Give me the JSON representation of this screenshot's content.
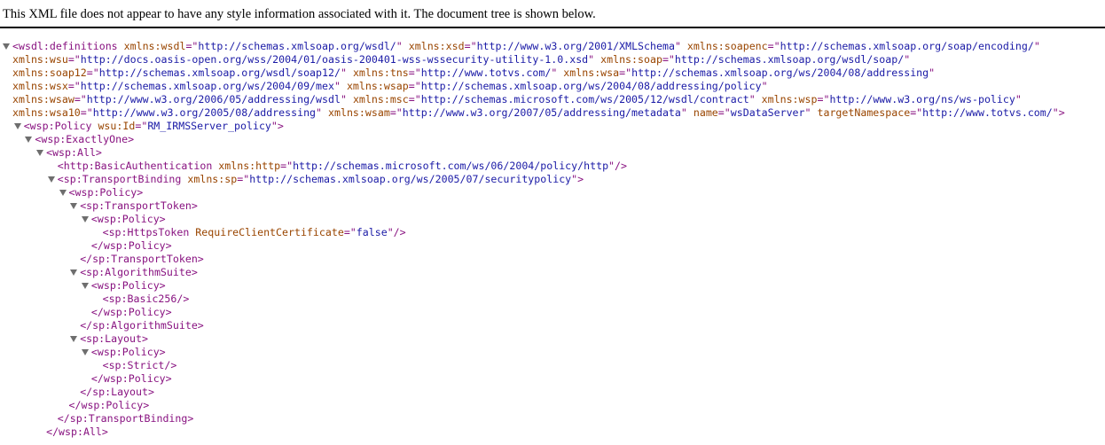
{
  "banner": "This XML file does not appear to have any style information associated with it. The document tree is shown below.",
  "lines": [
    {
      "indent": 0,
      "toggle": true,
      "segs": [
        [
          "t",
          "<wsdl:definitions "
        ],
        [
          "n",
          "xmlns:wsdl"
        ],
        [
          "t",
          "=\""
        ],
        [
          "v",
          "http://schemas.xmlsoap.org/wsdl/"
        ],
        [
          "t",
          "\" "
        ],
        [
          "n",
          "xmlns:xsd"
        ],
        [
          "t",
          "=\""
        ],
        [
          "v",
          "http://www.w3.org/2001/XMLSchema"
        ],
        [
          "t",
          "\" "
        ],
        [
          "n",
          "xmlns:soapenc"
        ],
        [
          "t",
          "=\""
        ],
        [
          "v",
          "http://schemas.xmlsoap.org/soap/encoding/"
        ],
        [
          "t",
          "\""
        ]
      ]
    },
    {
      "indent": 0,
      "wrap": true,
      "segs": [
        [
          "n",
          "xmlns:wsu"
        ],
        [
          "t",
          "=\""
        ],
        [
          "v",
          "http://docs.oasis-open.org/wss/2004/01/oasis-200401-wss-wssecurity-utility-1.0.xsd"
        ],
        [
          "t",
          "\" "
        ],
        [
          "n",
          "xmlns:soap"
        ],
        [
          "t",
          "=\""
        ],
        [
          "v",
          "http://schemas.xmlsoap.org/wsdl/soap/"
        ],
        [
          "t",
          "\""
        ]
      ]
    },
    {
      "indent": 0,
      "wrap": true,
      "segs": [
        [
          "n",
          "xmlns:soap12"
        ],
        [
          "t",
          "=\""
        ],
        [
          "v",
          "http://schemas.xmlsoap.org/wsdl/soap12/"
        ],
        [
          "t",
          "\" "
        ],
        [
          "n",
          "xmlns:tns"
        ],
        [
          "t",
          "=\""
        ],
        [
          "v",
          "http://www.totvs.com/"
        ],
        [
          "t",
          "\" "
        ],
        [
          "n",
          "xmlns:wsa"
        ],
        [
          "t",
          "=\""
        ],
        [
          "v",
          "http://schemas.xmlsoap.org/ws/2004/08/addressing"
        ],
        [
          "t",
          "\""
        ]
      ]
    },
    {
      "indent": 0,
      "wrap": true,
      "segs": [
        [
          "n",
          "xmlns:wsx"
        ],
        [
          "t",
          "=\""
        ],
        [
          "v",
          "http://schemas.xmlsoap.org/ws/2004/09/mex"
        ],
        [
          "t",
          "\" "
        ],
        [
          "n",
          "xmlns:wsap"
        ],
        [
          "t",
          "=\""
        ],
        [
          "v",
          "http://schemas.xmlsoap.org/ws/2004/08/addressing/policy"
        ],
        [
          "t",
          "\""
        ]
      ]
    },
    {
      "indent": 0,
      "wrap": true,
      "segs": [
        [
          "n",
          "xmlns:wsaw"
        ],
        [
          "t",
          "=\""
        ],
        [
          "v",
          "http://www.w3.org/2006/05/addressing/wsdl"
        ],
        [
          "t",
          "\" "
        ],
        [
          "n",
          "xmlns:msc"
        ],
        [
          "t",
          "=\""
        ],
        [
          "v",
          "http://schemas.microsoft.com/ws/2005/12/wsdl/contract"
        ],
        [
          "t",
          "\" "
        ],
        [
          "n",
          "xmlns:wsp"
        ],
        [
          "t",
          "=\""
        ],
        [
          "v",
          "http://www.w3.org/ns/ws-policy"
        ],
        [
          "t",
          "\""
        ]
      ]
    },
    {
      "indent": 0,
      "wrap": true,
      "segs": [
        [
          "n",
          "xmlns:wsa10"
        ],
        [
          "t",
          "=\""
        ],
        [
          "v",
          "http://www.w3.org/2005/08/addressing"
        ],
        [
          "t",
          "\" "
        ],
        [
          "n",
          "xmlns:wsam"
        ],
        [
          "t",
          "=\""
        ],
        [
          "v",
          "http://www.w3.org/2007/05/addressing/metadata"
        ],
        [
          "t",
          "\" "
        ],
        [
          "n",
          "name"
        ],
        [
          "t",
          "=\""
        ],
        [
          "v",
          "wsDataServer"
        ],
        [
          "t",
          "\" "
        ],
        [
          "n",
          "targetNamespace"
        ],
        [
          "t",
          "=\""
        ],
        [
          "v",
          "http://www.totvs.com/"
        ],
        [
          "t",
          "\">"
        ]
      ]
    },
    {
      "indent": 1,
      "toggle": true,
      "segs": [
        [
          "t",
          "<wsp:Policy "
        ],
        [
          "n",
          "wsu:Id"
        ],
        [
          "t",
          "=\""
        ],
        [
          "v",
          "RM_IRMSServer_policy"
        ],
        [
          "t",
          "\">"
        ]
      ]
    },
    {
      "indent": 2,
      "toggle": true,
      "segs": [
        [
          "t",
          "<wsp:ExactlyOne>"
        ]
      ]
    },
    {
      "indent": 3,
      "toggle": true,
      "segs": [
        [
          "t",
          "<wsp:All>"
        ]
      ]
    },
    {
      "indent": 4,
      "toggle": false,
      "segs": [
        [
          "t",
          "<http:BasicAuthentication "
        ],
        [
          "n",
          "xmlns:http"
        ],
        [
          "t",
          "=\""
        ],
        [
          "v",
          "http://schemas.microsoft.com/ws/06/2004/policy/http"
        ],
        [
          "t",
          "\"/>"
        ]
      ]
    },
    {
      "indent": 4,
      "toggle": true,
      "segs": [
        [
          "t",
          "<sp:TransportBinding "
        ],
        [
          "n",
          "xmlns:sp"
        ],
        [
          "t",
          "=\""
        ],
        [
          "v",
          "http://schemas.xmlsoap.org/ws/2005/07/securitypolicy"
        ],
        [
          "t",
          "\">"
        ]
      ]
    },
    {
      "indent": 5,
      "toggle": true,
      "segs": [
        [
          "t",
          "<wsp:Policy>"
        ]
      ]
    },
    {
      "indent": 6,
      "toggle": true,
      "segs": [
        [
          "t",
          "<sp:TransportToken>"
        ]
      ]
    },
    {
      "indent": 7,
      "toggle": true,
      "segs": [
        [
          "t",
          "<wsp:Policy>"
        ]
      ]
    },
    {
      "indent": 8,
      "toggle": false,
      "segs": [
        [
          "t",
          "<sp:HttpsToken "
        ],
        [
          "n",
          "RequireClientCertificate"
        ],
        [
          "t",
          "=\""
        ],
        [
          "v",
          "false"
        ],
        [
          "t",
          "\"/>"
        ]
      ]
    },
    {
      "indent": 7,
      "toggle": false,
      "segs": [
        [
          "t",
          "</wsp:Policy>"
        ]
      ]
    },
    {
      "indent": 6,
      "toggle": false,
      "segs": [
        [
          "t",
          "</sp:TransportToken>"
        ]
      ]
    },
    {
      "indent": 6,
      "toggle": true,
      "segs": [
        [
          "t",
          "<sp:AlgorithmSuite>"
        ]
      ]
    },
    {
      "indent": 7,
      "toggle": true,
      "segs": [
        [
          "t",
          "<wsp:Policy>"
        ]
      ]
    },
    {
      "indent": 8,
      "toggle": false,
      "segs": [
        [
          "t",
          "<sp:Basic256/>"
        ]
      ]
    },
    {
      "indent": 7,
      "toggle": false,
      "segs": [
        [
          "t",
          "</wsp:Policy>"
        ]
      ]
    },
    {
      "indent": 6,
      "toggle": false,
      "segs": [
        [
          "t",
          "</sp:AlgorithmSuite>"
        ]
      ]
    },
    {
      "indent": 6,
      "toggle": true,
      "segs": [
        [
          "t",
          "<sp:Layout>"
        ]
      ]
    },
    {
      "indent": 7,
      "toggle": true,
      "segs": [
        [
          "t",
          "<wsp:Policy>"
        ]
      ]
    },
    {
      "indent": 8,
      "toggle": false,
      "segs": [
        [
          "t",
          "<sp:Strict/>"
        ]
      ]
    },
    {
      "indent": 7,
      "toggle": false,
      "segs": [
        [
          "t",
          "</wsp:Policy>"
        ]
      ]
    },
    {
      "indent": 6,
      "toggle": false,
      "segs": [
        [
          "t",
          "</sp:Layout>"
        ]
      ]
    },
    {
      "indent": 5,
      "toggle": false,
      "segs": [
        [
          "t",
          "</wsp:Policy>"
        ]
      ]
    },
    {
      "indent": 4,
      "toggle": false,
      "segs": [
        [
          "t",
          "</sp:TransportBinding>"
        ]
      ]
    },
    {
      "indent": 3,
      "toggle": false,
      "segs": [
        [
          "t",
          "</wsp:All>"
        ]
      ]
    }
  ]
}
